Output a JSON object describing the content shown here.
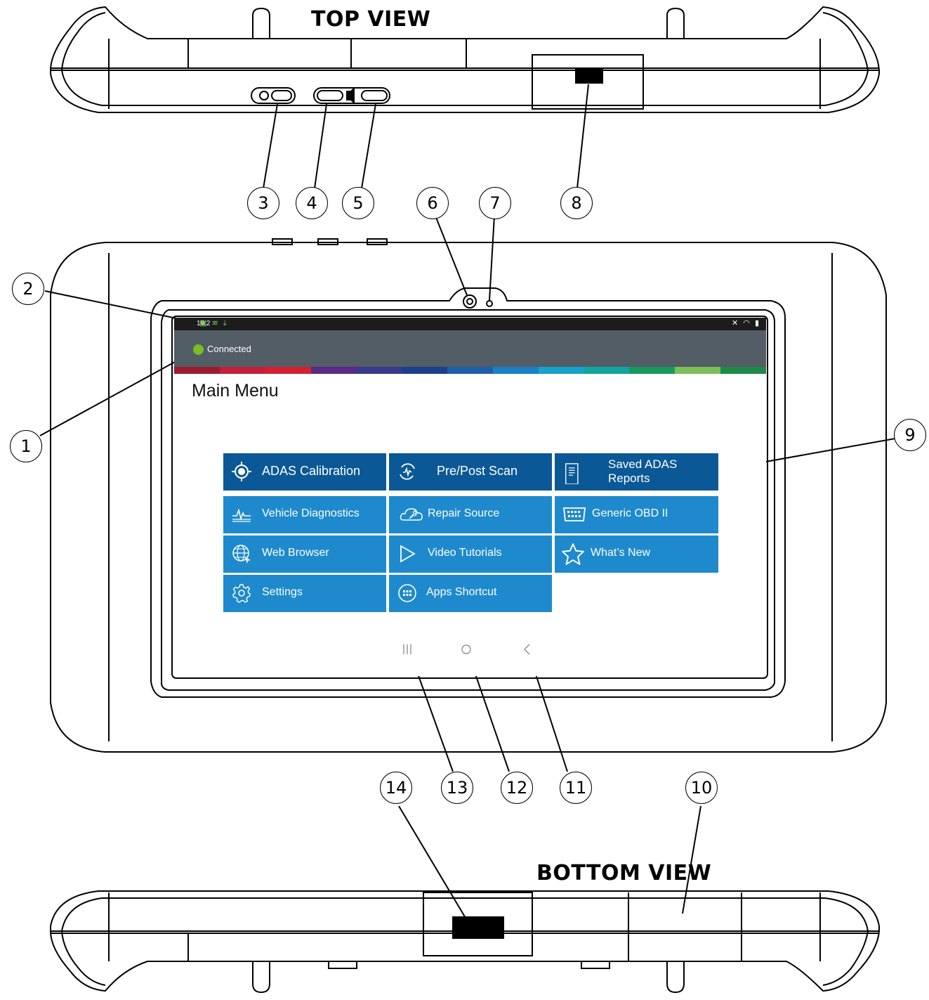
{
  "views": {
    "top": "TOP VIEW",
    "bottom": "BOTTOM VIEW"
  },
  "callouts": [
    "1",
    "2",
    "3",
    "4",
    "5",
    "6",
    "7",
    "8",
    "9",
    "10",
    "11",
    "12",
    "13",
    "14"
  ],
  "screen": {
    "status_time": "10:2",
    "connection": "Connected",
    "title": "Main Menu",
    "stripe_colors": [
      "#9a1c2e",
      "#c41f3a",
      "#d3202f",
      "#5a2a86",
      "#3a3a8c",
      "#1d3f8c",
      "#1f5ea8",
      "#1a80c4",
      "#17a2c9",
      "#11a5a0",
      "#179a5c",
      "#7dbd5a",
      "#1d8a47"
    ],
    "tiles": [
      {
        "label": "ADAS Calibration",
        "icon": "target-icon"
      },
      {
        "label": "Pre/Post Scan",
        "icon": "scan-cycle-icon"
      },
      {
        "label": "Saved ADAS Reports",
        "icon": "report-document-icon"
      },
      {
        "label": "Vehicle Diagnostics",
        "icon": "waveform-icon"
      },
      {
        "label": "Repair Source",
        "icon": "cloud-wrench-icon"
      },
      {
        "label": "Generic OBD II",
        "icon": "obd-connector-icon"
      },
      {
        "label": "Web Browser",
        "icon": "globe-cursor-icon"
      },
      {
        "label": "Video Tutorials",
        "icon": "play-icon"
      },
      {
        "label": "What’s New",
        "icon": "star-icon"
      },
      {
        "label": "Settings",
        "icon": "gear-icon"
      },
      {
        "label": "Apps Shortcut",
        "icon": "apps-grid-icon"
      }
    ],
    "nav": {
      "recents": "recent-apps-icon",
      "home": "home-icon",
      "back": "back-icon"
    }
  },
  "colors": {
    "tile_dark": "#0b5896",
    "tile_light": "#1e8acd",
    "appbar": "#525d66",
    "connected": "#78be20"
  }
}
